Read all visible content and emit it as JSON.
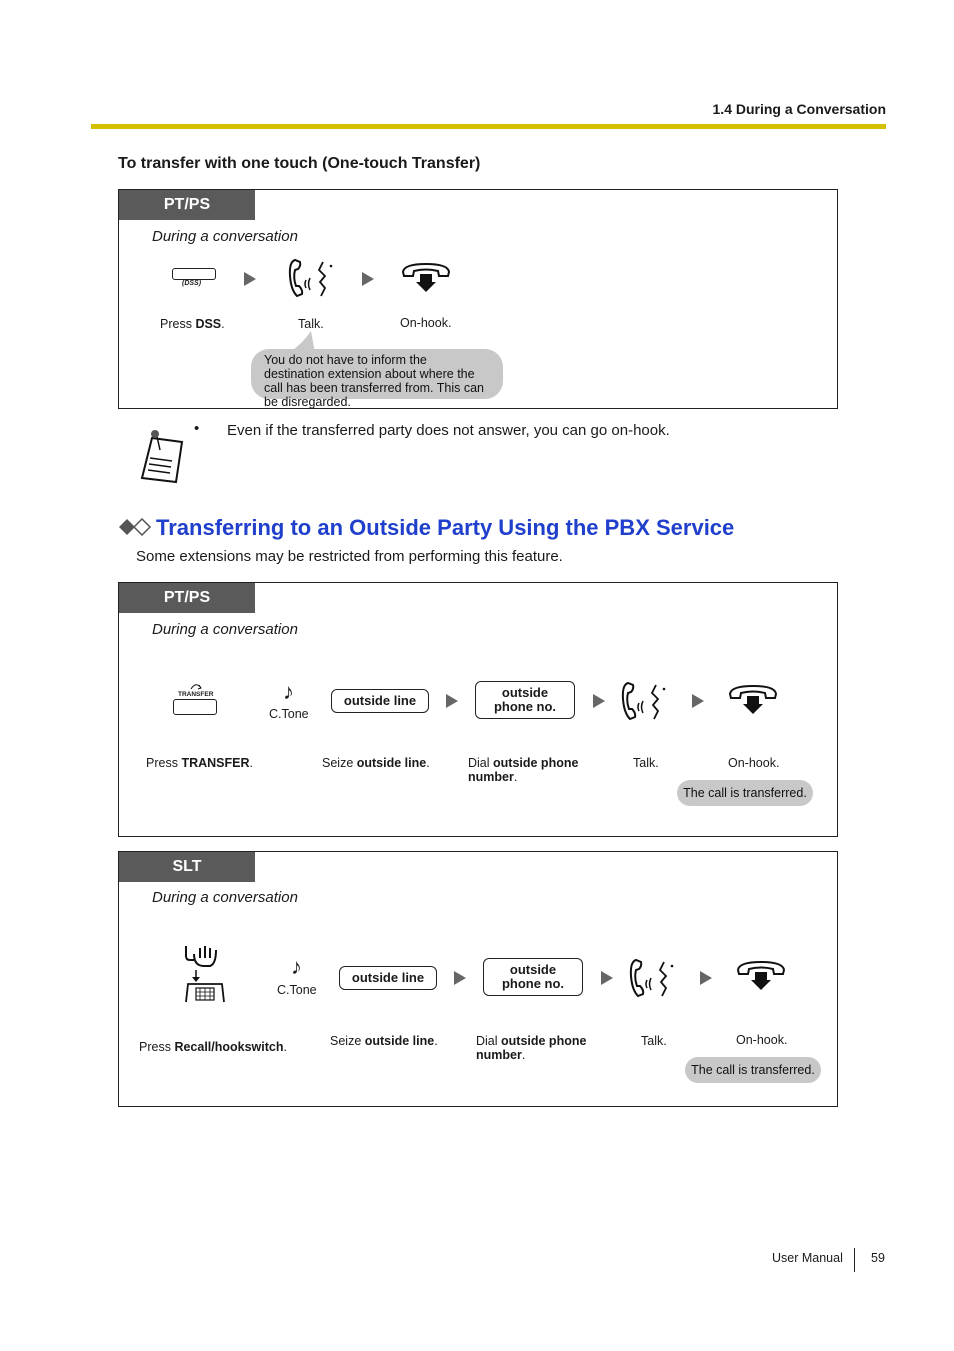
{
  "header": {
    "section_title": "1.4 During a Conversation",
    "rule_color": "#d4c000"
  },
  "one_touch": {
    "heading": "To transfer with one touch (One-touch Transfer)",
    "panel": {
      "tag": "PT/PS",
      "context": "During a conversation",
      "dss_key_label": "(DSS)",
      "steps": [
        {
          "icon": "dss-key-icon",
          "caption_pre": "Press ",
          "caption_bold": "DSS",
          "caption_post": "."
        },
        {
          "icon": "talk-icon",
          "caption_pre": "Talk.",
          "caption_bold": "",
          "caption_post": ""
        },
        {
          "icon": "on-hook-icon",
          "caption_pre": "On-hook.",
          "caption_bold": "",
          "caption_post": ""
        }
      ],
      "bubble": "You do not have to inform the destination extension about where the call has been transferred from. This can be disregarded."
    },
    "note": {
      "icon": "notepad-icon",
      "bullet": "•",
      "text": "Even if the transferred party does not answer, you can go on-hook."
    }
  },
  "outside_party": {
    "title_icon": "double-diamond-icon",
    "title": "Transferring to an Outside Party Using the PBX Service",
    "title_color": "#1f3fcc",
    "description": "Some extensions may be restricted from performing this feature.",
    "pt_ps_panel": {
      "tag": "PT/PS",
      "context": "During a conversation",
      "transfer_key_label": "TRANSFER",
      "ctone": "C.Tone",
      "outside_line_button": "outside line",
      "phone_no_button_line1": "outside",
      "phone_no_button_line2": "phone no.",
      "captions": {
        "press_pre": "Press ",
        "press_bold": "TRANSFER",
        "press_post": ".",
        "seize_pre": "Seize ",
        "seize_bold": "outside line",
        "seize_post": ".",
        "dial_pre": "Dial ",
        "dial_bold1": "outside phone",
        "dial_bold2": "number",
        "dial_post": ".",
        "talk": "Talk.",
        "onhook": "On-hook."
      },
      "bubble": "The call is transferred."
    },
    "slt_panel": {
      "tag": "SLT",
      "context": "During a conversation",
      "ctone": "C.Tone",
      "outside_line_button": "outside line",
      "phone_no_button_line1": "outside",
      "phone_no_button_line2": "phone no.",
      "captions": {
        "press_pre": "Press ",
        "press_bold": "Recall/hookswitch",
        "press_post": ".",
        "seize_pre": "Seize ",
        "seize_bold": "outside line",
        "seize_post": ".",
        "dial_pre": "Dial ",
        "dial_bold1": "outside phone",
        "dial_bold2": "number",
        "dial_post": ".",
        "talk": "Talk.",
        "onhook": "On-hook."
      },
      "bubble": "The call is transferred."
    }
  },
  "footer": {
    "label": "User Manual",
    "page_number": "59"
  }
}
